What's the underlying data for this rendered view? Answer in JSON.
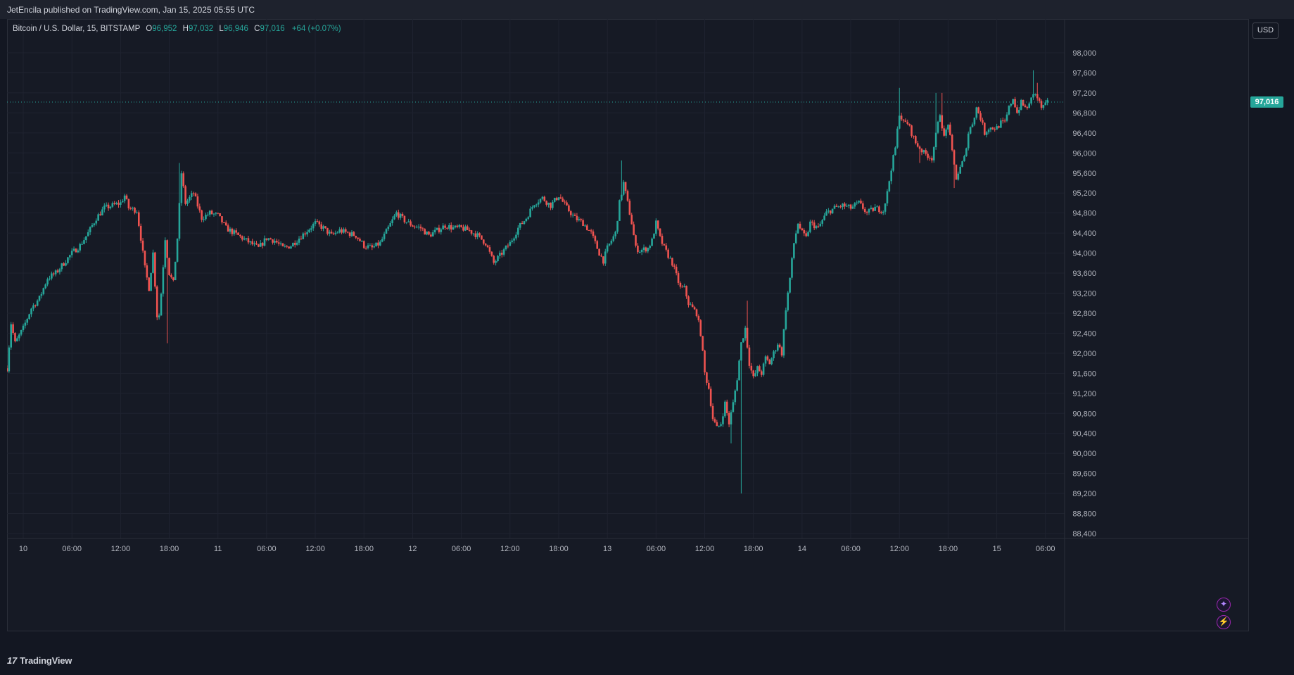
{
  "header": {
    "published_text": "JetEncila published on TradingView.com, Jan 15, 2025 05:55 UTC"
  },
  "legend": {
    "symbol": "Bitcoin / U.S. Dollar, 15, BITSTAMP",
    "open_label": "O",
    "open": "96,952",
    "high_label": "H",
    "high": "97,032",
    "low_label": "L",
    "low": "96,946",
    "close_label": "C",
    "close": "97,016",
    "change": "+64 (+0.07%)"
  },
  "currency_button": "USD",
  "last_price_tag": "97,016",
  "footer": {
    "logo": "17",
    "brand": "TradingView"
  },
  "icons": [
    "spark-icon",
    "lightning-icon"
  ],
  "colors": {
    "up": "#26a69a",
    "down": "#ef5350",
    "background": "#131722",
    "grid": "#1f2330"
  },
  "chart_data": {
    "type": "candlestick",
    "interval": "15",
    "ylim": [
      88400,
      98000
    ],
    "y_ticks": [
      "98,000",
      "97,600",
      "97,200",
      "96,800",
      "96,400",
      "96,000",
      "95,600",
      "95,200",
      "94,800",
      "94,400",
      "94,000",
      "93,600",
      "93,200",
      "92,800",
      "92,400",
      "92,000",
      "91,600",
      "91,200",
      "90,800",
      "90,400",
      "90,000",
      "89,600",
      "89,200",
      "88,800",
      "88,400"
    ],
    "x_ticks": [
      "10",
      "06:00",
      "12:00",
      "18:00",
      "11",
      "06:00",
      "12:00",
      "18:00",
      "12",
      "06:00",
      "12:00",
      "18:00",
      "13",
      "06:00",
      "12:00",
      "18:00",
      "14",
      "06:00",
      "12:00",
      "18:00",
      "15",
      "06:00"
    ],
    "x_tick_hours": [
      0,
      6,
      12,
      18,
      24,
      30,
      36,
      42,
      48,
      54,
      60,
      66,
      72,
      78,
      84,
      90,
      96,
      102,
      108,
      114,
      120,
      126
    ],
    "start_hour": -2.0,
    "last_close": 97016,
    "anchors": [
      [
        -2.0,
        91700
      ],
      [
        -1.5,
        92600
      ],
      [
        -1.0,
        92200
      ],
      [
        0.0,
        92500
      ],
      [
        1.0,
        92900
      ],
      [
        2.0,
        93100
      ],
      [
        3.0,
        93500
      ],
      [
        4.0,
        93600
      ],
      [
        5.0,
        93800
      ],
      [
        6.0,
        94000
      ],
      [
        7.0,
        94150
      ],
      [
        8.0,
        94400
      ],
      [
        9.0,
        94700
      ],
      [
        10.0,
        94900
      ],
      [
        11.0,
        94950
      ],
      [
        12.0,
        95000
      ],
      [
        12.5,
        95150
      ],
      [
        13.0,
        94900
      ],
      [
        14.0,
        94850
      ],
      [
        14.5,
        94300
      ],
      [
        15.0,
        93700
      ],
      [
        15.5,
        93300
      ],
      [
        16.0,
        94000
      ],
      [
        16.6,
        92500
      ],
      [
        17.0,
        93200
      ],
      [
        17.5,
        94300
      ],
      [
        18.0,
        93600
      ],
      [
        18.5,
        93400
      ],
      [
        19.0,
        94300
      ],
      [
        19.5,
        95600
      ],
      [
        20.0,
        95000
      ],
      [
        21.0,
        95200
      ],
      [
        22.0,
        94700
      ],
      [
        23.0,
        94800
      ],
      [
        24.0,
        94750
      ],
      [
        25.0,
        94500
      ],
      [
        26.0,
        94400
      ],
      [
        27.0,
        94300
      ],
      [
        28.0,
        94200
      ],
      [
        29.0,
        94100
      ],
      [
        30.0,
        94300
      ],
      [
        31.0,
        94250
      ],
      [
        32.0,
        94100
      ],
      [
        33.0,
        94150
      ],
      [
        34.0,
        94300
      ],
      [
        35.0,
        94450
      ],
      [
        36.0,
        94600
      ],
      [
        37.0,
        94500
      ],
      [
        38.0,
        94350
      ],
      [
        39.0,
        94450
      ],
      [
        40.0,
        94400
      ],
      [
        41.0,
        94350
      ],
      [
        42.0,
        94150
      ],
      [
        43.0,
        94100
      ],
      [
        44.0,
        94200
      ],
      [
        45.0,
        94500
      ],
      [
        46.0,
        94800
      ],
      [
        47.0,
        94650
      ],
      [
        48.0,
        94550
      ],
      [
        49.0,
        94500
      ],
      [
        50.0,
        94350
      ],
      [
        51.0,
        94450
      ],
      [
        52.0,
        94550
      ],
      [
        53.0,
        94500
      ],
      [
        54.0,
        94500
      ],
      [
        55.0,
        94450
      ],
      [
        56.0,
        94350
      ],
      [
        57.0,
        94200
      ],
      [
        58.0,
        93800
      ],
      [
        59.0,
        94000
      ],
      [
        60.0,
        94200
      ],
      [
        61.0,
        94500
      ],
      [
        62.0,
        94700
      ],
      [
        63.0,
        95000
      ],
      [
        64.0,
        95100
      ],
      [
        65.0,
        94950
      ],
      [
        66.0,
        95150
      ],
      [
        67.0,
        94900
      ],
      [
        68.0,
        94700
      ],
      [
        69.0,
        94600
      ],
      [
        70.0,
        94400
      ],
      [
        71.0,
        94000
      ],
      [
        71.5,
        93850
      ],
      [
        72.0,
        94100
      ],
      [
        73.0,
        94400
      ],
      [
        73.5,
        95000
      ],
      [
        74.0,
        95400
      ],
      [
        74.5,
        95000
      ],
      [
        75.0,
        94600
      ],
      [
        75.5,
        94100
      ],
      [
        76.0,
        94050
      ],
      [
        77.0,
        94100
      ],
      [
        77.5,
        94250
      ],
      [
        78.0,
        94600
      ],
      [
        78.5,
        94300
      ],
      [
        79.0,
        94100
      ],
      [
        80.0,
        93800
      ],
      [
        81.0,
        93300
      ],
      [
        81.5,
        93300
      ],
      [
        82.0,
        93000
      ],
      [
        83.0,
        92800
      ],
      [
        83.5,
        92400
      ],
      [
        84.0,
        91600
      ],
      [
        84.5,
        91300
      ],
      [
        85.0,
        90700
      ],
      [
        85.5,
        90500
      ],
      [
        86.0,
        90600
      ],
      [
        86.5,
        91000
      ],
      [
        87.0,
        90600
      ],
      [
        87.5,
        91000
      ],
      [
        88.0,
        91500
      ],
      [
        88.5,
        92200
      ],
      [
        89.0,
        92500
      ],
      [
        89.5,
        91800
      ],
      [
        90.0,
        91500
      ],
      [
        90.5,
        91700
      ],
      [
        91.0,
        91600
      ],
      [
        91.5,
        91900
      ],
      [
        92.0,
        91800
      ],
      [
        92.5,
        92000
      ],
      [
        93.0,
        92200
      ],
      [
        93.5,
        92000
      ],
      [
        94.0,
        92900
      ],
      [
        94.5,
        93500
      ],
      [
        95.0,
        94200
      ],
      [
        95.5,
        94600
      ],
      [
        96.0,
        94400
      ],
      [
        96.5,
        94300
      ],
      [
        97.0,
        94600
      ],
      [
        98.0,
        94500
      ],
      [
        99.0,
        94800
      ],
      [
        100.0,
        94900
      ],
      [
        101.0,
        94950
      ],
      [
        102.0,
        94900
      ],
      [
        103.0,
        95000
      ],
      [
        104.0,
        94800
      ],
      [
        105.0,
        94900
      ],
      [
        106.0,
        94850
      ],
      [
        106.5,
        95200
      ],
      [
        107.0,
        95700
      ],
      [
        107.5,
        96100
      ],
      [
        108.0,
        96800
      ],
      [
        108.5,
        96600
      ],
      [
        109.0,
        96600
      ],
      [
        109.5,
        96400
      ],
      [
        110.0,
        96200
      ],
      [
        111.0,
        96000
      ],
      [
        112.0,
        95900
      ],
      [
        113.0,
        96800
      ],
      [
        113.5,
        96300
      ],
      [
        114.0,
        96600
      ],
      [
        114.5,
        96000
      ],
      [
        115.0,
        95500
      ],
      [
        116.0,
        95900
      ],
      [
        116.5,
        96400
      ],
      [
        117.0,
        96600
      ],
      [
        117.5,
        96900
      ],
      [
        118.0,
        96700
      ],
      [
        118.5,
        96400
      ],
      [
        119.0,
        96500
      ],
      [
        120.0,
        96500
      ],
      [
        120.5,
        96600
      ],
      [
        121.0,
        96600
      ],
      [
        121.5,
        96900
      ],
      [
        122.0,
        97100
      ],
      [
        122.5,
        96800
      ],
      [
        123.0,
        97000
      ],
      [
        123.5,
        96900
      ],
      [
        124.0,
        96950
      ],
      [
        124.5,
        97200
      ],
      [
        125.0,
        97100
      ],
      [
        125.5,
        96900
      ],
      [
        126.0,
        96950
      ],
      [
        126.3,
        97016
      ]
    ],
    "spikes": [
      [
        16.6,
        92700,
        "low"
      ],
      [
        17.8,
        92200,
        "low"
      ],
      [
        19.3,
        95800,
        "high"
      ],
      [
        73.8,
        95850,
        "high"
      ],
      [
        88.6,
        89200,
        "low"
      ],
      [
        87.3,
        90200,
        "low"
      ],
      [
        89.3,
        93050,
        "high"
      ],
      [
        107.9,
        97300,
        "high"
      ],
      [
        110.4,
        95800,
        "low"
      ],
      [
        112.4,
        97200,
        "high"
      ],
      [
        113.3,
        97200,
        "high"
      ],
      [
        114.8,
        95300,
        "low"
      ],
      [
        124.6,
        97650,
        "high"
      ],
      [
        124.9,
        97400,
        "high"
      ]
    ]
  }
}
